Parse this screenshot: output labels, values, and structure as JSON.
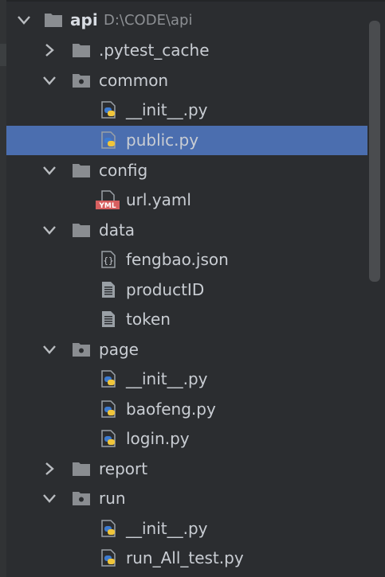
{
  "tree": {
    "root": {
      "label": "api",
      "path": "D:\\CODE\\api"
    },
    "items": [
      {
        "label": ".pytest_cache",
        "kind": "folder",
        "expanded": false
      },
      {
        "label": "common",
        "kind": "package",
        "expanded": true
      },
      {
        "label": "__init__.py",
        "kind": "python"
      },
      {
        "label": "public.py",
        "kind": "python",
        "selected": true
      },
      {
        "label": "config",
        "kind": "folder",
        "expanded": true
      },
      {
        "label": "url.yaml",
        "kind": "yaml",
        "badge": "YML"
      },
      {
        "label": "data",
        "kind": "folder",
        "expanded": true
      },
      {
        "label": "fengbao.json",
        "kind": "json"
      },
      {
        "label": "productID",
        "kind": "text"
      },
      {
        "label": "token",
        "kind": "text"
      },
      {
        "label": "page",
        "kind": "package",
        "expanded": true
      },
      {
        "label": "__init__.py",
        "kind": "python"
      },
      {
        "label": "baofeng.py",
        "kind": "python"
      },
      {
        "label": "login.py",
        "kind": "python"
      },
      {
        "label": "report",
        "kind": "folder",
        "expanded": false
      },
      {
        "label": "run",
        "kind": "package",
        "expanded": true
      },
      {
        "label": "__init__.py",
        "kind": "python"
      },
      {
        "label": "run_All_test.py",
        "kind": "python"
      }
    ]
  },
  "colors": {
    "background": "#2b2d30",
    "selection": "#4b6eaf",
    "folder": "#8a8d91",
    "python_blue": "#3d7bd0",
    "python_yellow": "#f0c53a",
    "yaml_red": "#d75f5f"
  }
}
